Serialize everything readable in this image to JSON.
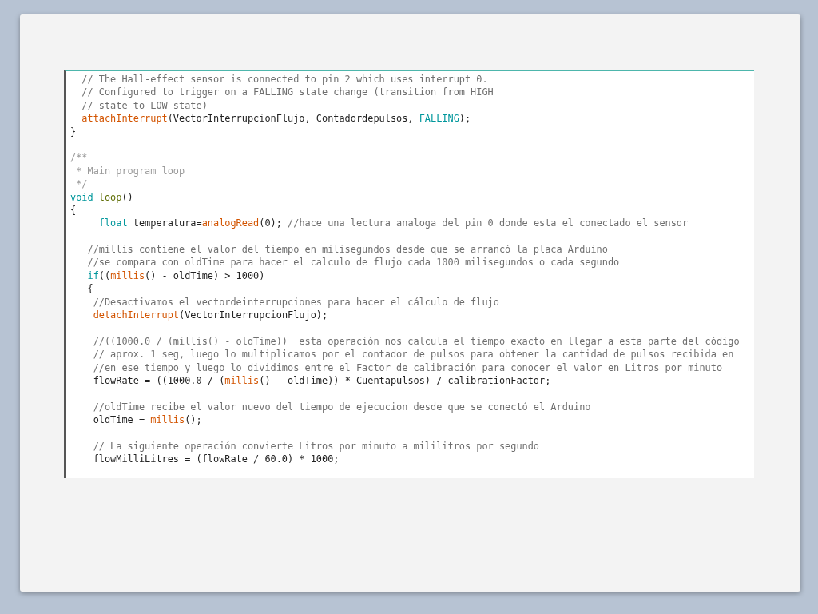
{
  "code_lines": [
    {
      "kind": "code",
      "tokens": [
        {
          "kind": "comment",
          "text": "  // The Hall-effect sensor is connected to pin 2 which uses interrupt 0."
        }
      ]
    },
    {
      "kind": "code",
      "tokens": [
        {
          "kind": "comment",
          "text": "  // Configured to trigger on a FALLING state change (transition from HIGH"
        }
      ]
    },
    {
      "kind": "code",
      "tokens": [
        {
          "kind": "comment",
          "text": "  // state to LOW state)"
        }
      ]
    },
    {
      "kind": "code",
      "tokens": [
        {
          "kind": "function",
          "text": "  attachInterrupt"
        },
        {
          "kind": "plain",
          "text": "(VectorInterrupcionFlujo, Contadordepulsos, "
        },
        {
          "kind": "constant",
          "text": "FALLING"
        },
        {
          "kind": "plain",
          "text": ");"
        }
      ]
    },
    {
      "kind": "code",
      "tokens": [
        {
          "kind": "plain",
          "text": "}"
        }
      ]
    },
    {
      "kind": "blank"
    },
    {
      "kind": "code",
      "tokens": [
        {
          "kind": "doc",
          "text": "/**"
        }
      ]
    },
    {
      "kind": "code",
      "tokens": [
        {
          "kind": "doc",
          "text": " * Main program loop"
        }
      ]
    },
    {
      "kind": "code",
      "tokens": [
        {
          "kind": "doc",
          "text": " */"
        }
      ]
    },
    {
      "kind": "code",
      "tokens": [
        {
          "kind": "keyword",
          "text": "void"
        },
        {
          "kind": "entry",
          "text": " loop"
        },
        {
          "kind": "plain",
          "text": "()"
        }
      ]
    },
    {
      "kind": "code",
      "tokens": [
        {
          "kind": "plain",
          "text": "{"
        }
      ]
    },
    {
      "kind": "code",
      "tokens": [
        {
          "kind": "keyword",
          "text": "     float"
        },
        {
          "kind": "plain",
          "text": " temperatura="
        },
        {
          "kind": "function",
          "text": "analogRead"
        },
        {
          "kind": "plain",
          "text": "(0); "
        },
        {
          "kind": "comment",
          "text": "//hace una lectura analoga del pin 0 donde esta el conectado el sensor"
        }
      ]
    },
    {
      "kind": "blank"
    },
    {
      "kind": "code",
      "tokens": [
        {
          "kind": "comment",
          "text": "   //millis contiene el valor del tiempo en milisegundos desde que se arrancó la placa Arduino"
        }
      ]
    },
    {
      "kind": "code",
      "tokens": [
        {
          "kind": "comment",
          "text": "   //se compara con oldTime para hacer el calculo de flujo cada 1000 milisegundos o cada segundo"
        }
      ]
    },
    {
      "kind": "code",
      "tokens": [
        {
          "kind": "keyword",
          "text": "   if"
        },
        {
          "kind": "plain",
          "text": "(("
        },
        {
          "kind": "function",
          "text": "millis"
        },
        {
          "kind": "plain",
          "text": "() - oldTime) > 1000)"
        }
      ]
    },
    {
      "kind": "code",
      "tokens": [
        {
          "kind": "plain",
          "text": "   {"
        }
      ]
    },
    {
      "kind": "code",
      "tokens": [
        {
          "kind": "comment",
          "text": "    //Desactivamos el vectordeinterrupciones para hacer el cálculo de flujo"
        }
      ]
    },
    {
      "kind": "code",
      "tokens": [
        {
          "kind": "function",
          "text": "    detachInterrupt"
        },
        {
          "kind": "plain",
          "text": "(VectorInterrupcionFlujo);"
        }
      ]
    },
    {
      "kind": "blank"
    },
    {
      "kind": "code",
      "tokens": [
        {
          "kind": "comment",
          "text": "    //((1000.0 / (millis() - oldTime))  esta operación nos calcula el tiempo exacto en llegar a esta parte del código"
        }
      ]
    },
    {
      "kind": "code",
      "tokens": [
        {
          "kind": "comment",
          "text": "    // aprox. 1 seg, luego lo multiplicamos por el contador de pulsos para obtener la cantidad de pulsos recibida en"
        }
      ]
    },
    {
      "kind": "code",
      "tokens": [
        {
          "kind": "comment",
          "text": "    //en ese tiempo y luego lo dividimos entre el Factor de calibración para conocer el valor en Litros por minuto"
        }
      ]
    },
    {
      "kind": "code",
      "tokens": [
        {
          "kind": "plain",
          "text": "    flowRate = ((1000.0 / ("
        },
        {
          "kind": "function",
          "text": "millis"
        },
        {
          "kind": "plain",
          "text": "() - oldTime)) * Cuentapulsos) / calibrationFactor;"
        }
      ]
    },
    {
      "kind": "blank"
    },
    {
      "kind": "code",
      "tokens": [
        {
          "kind": "comment",
          "text": "    //oldTime recibe el valor nuevo del tiempo de ejecucion desde que se conectó el Arduino"
        }
      ]
    },
    {
      "kind": "code",
      "tokens": [
        {
          "kind": "plain",
          "text": "    oldTime = "
        },
        {
          "kind": "function",
          "text": "millis"
        },
        {
          "kind": "plain",
          "text": "();"
        }
      ]
    },
    {
      "kind": "blank"
    },
    {
      "kind": "code",
      "tokens": [
        {
          "kind": "comment",
          "text": "    // La siguiente operación convierte Litros por minuto a mililitros por segundo"
        }
      ]
    },
    {
      "kind": "code",
      "tokens": [
        {
          "kind": "plain",
          "text": "    flowMilliLitres = (flowRate / 60.0) * 1000;"
        }
      ]
    }
  ]
}
